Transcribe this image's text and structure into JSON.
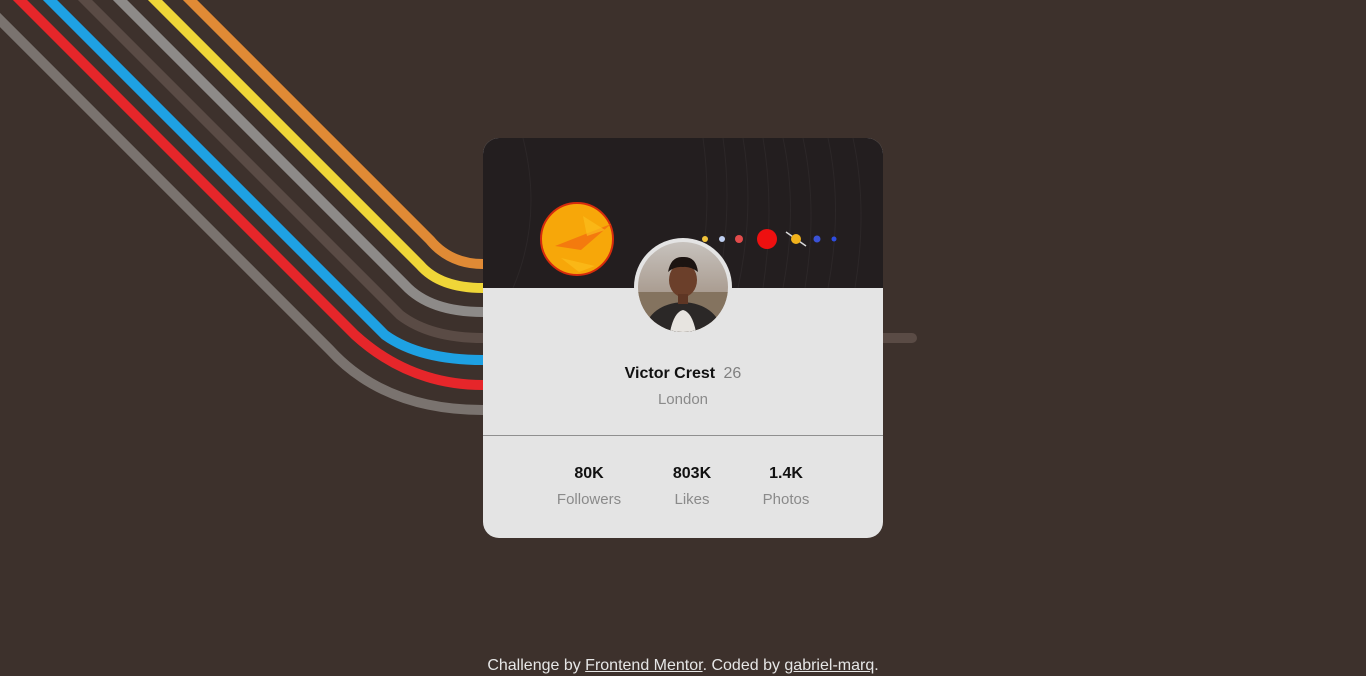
{
  "profile": {
    "name": "Victor Crest",
    "age": "26",
    "location": "London"
  },
  "stats": [
    {
      "value": "80K",
      "label": "Followers"
    },
    {
      "value": "803K",
      "label": "Likes"
    },
    {
      "value": "1.4K",
      "label": "Photos"
    }
  ],
  "footer": {
    "prefix": "Challenge by ",
    "mentor_link": "Frontend Mentor",
    "middle": ". Coded by ",
    "author_link": "gabriel-marq",
    "suffix": "."
  },
  "colors": {
    "background": "#3d312c",
    "card": "#e4e4e4",
    "header": "#231e1f",
    "stripe_orange": "#e08a35",
    "stripe_yellow": "#efd638",
    "stripe_gray": "#8d8a88",
    "stripe_blue": "#1ea1e3",
    "stripe_red": "#e6262a"
  }
}
